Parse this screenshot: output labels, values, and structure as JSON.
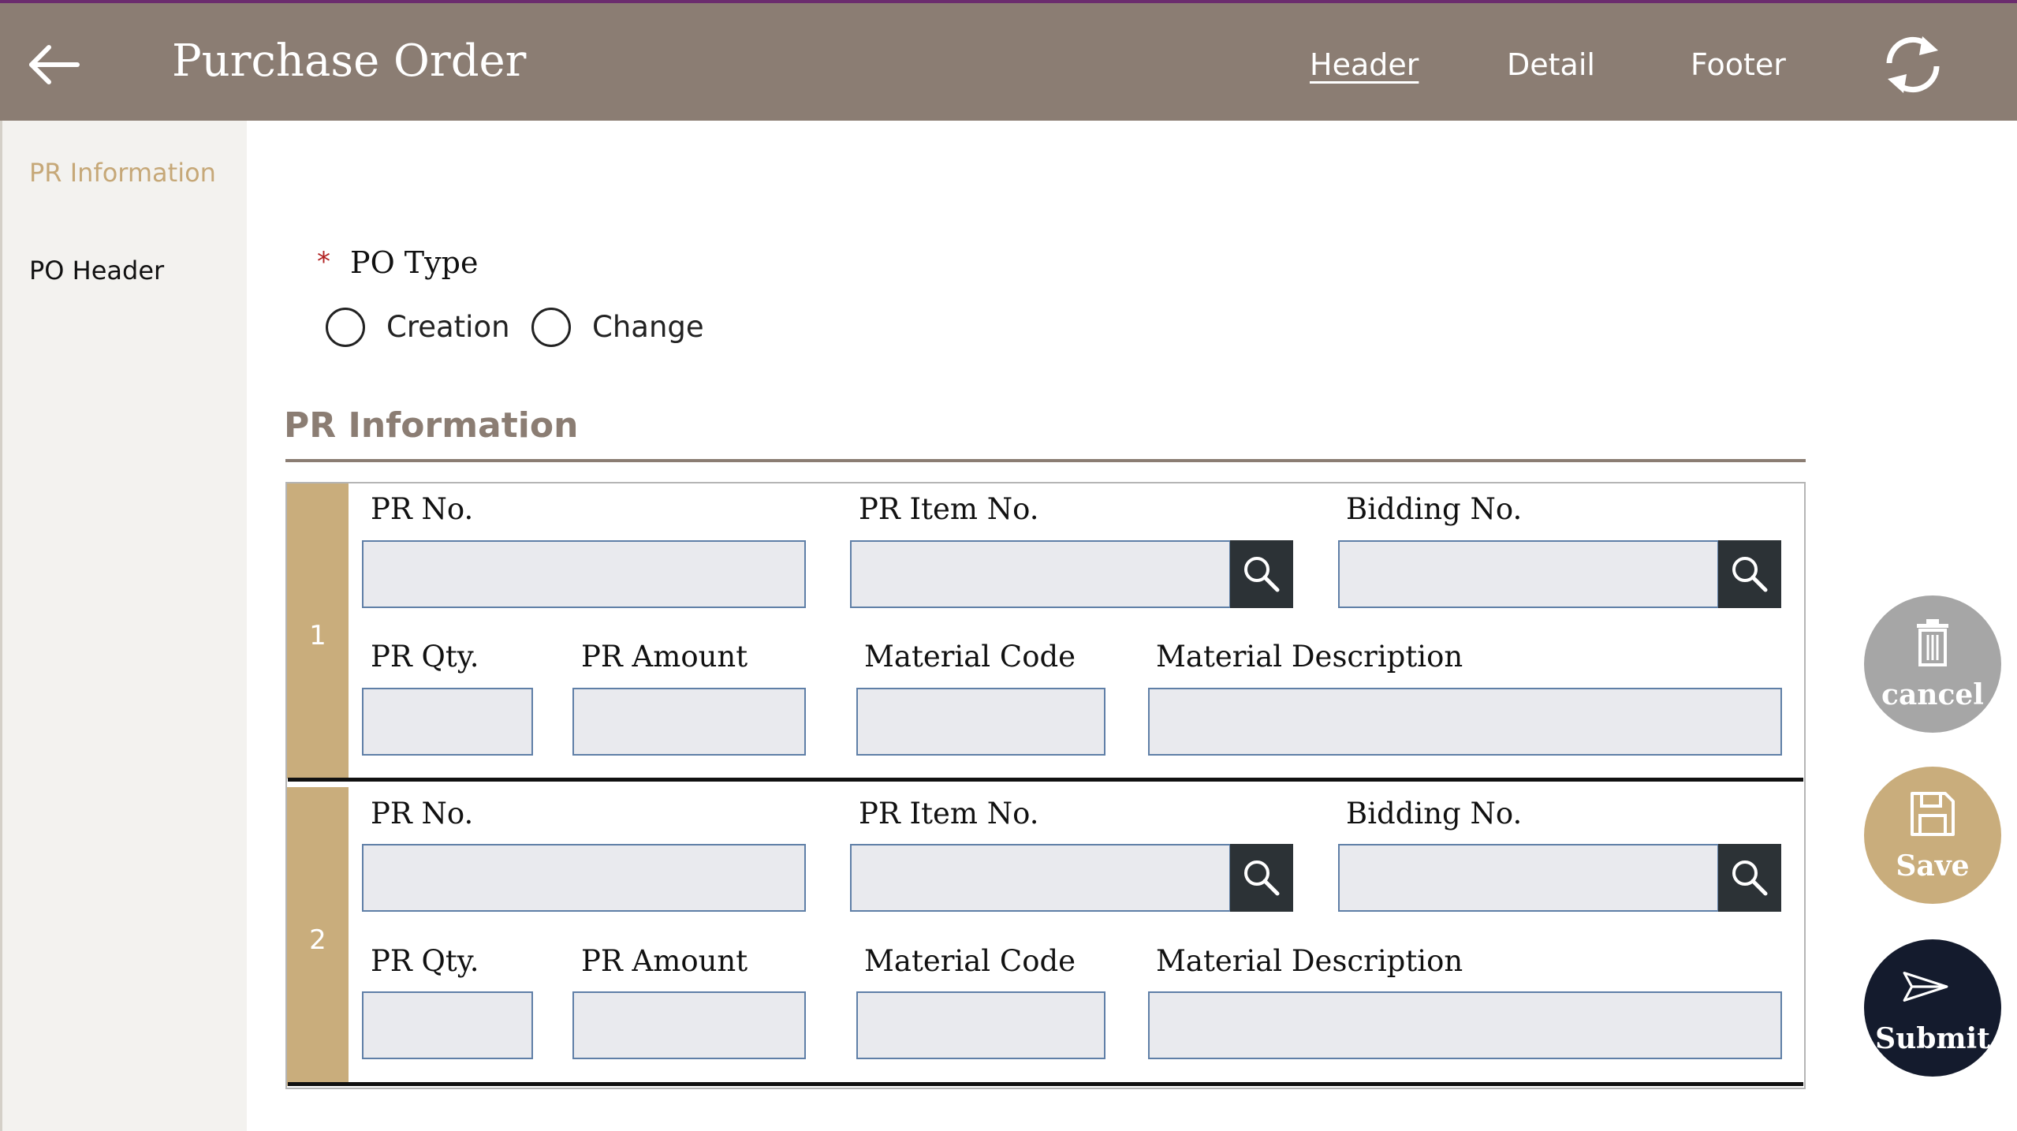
{
  "header": {
    "title": "Purchase Order",
    "tabs": [
      "Header",
      "Detail",
      "Footer"
    ],
    "active_tab": "Header"
  },
  "sidebar": {
    "items": [
      "PR Information",
      "PO Header"
    ],
    "active_item": "PR Information"
  },
  "po_type": {
    "label": "PO Type",
    "required_marker": "*",
    "options": [
      "Creation",
      "Change"
    ],
    "selected": null
  },
  "pr_section": {
    "title": "PR Information",
    "rows": [
      {
        "number": "1",
        "labels": {
          "pr_no": "PR No.",
          "pr_item_no": "PR Item No.",
          "bidding_no": "Bidding No.",
          "pr_qty": "PR Qty.",
          "pr_amount": "PR Amount",
          "material_code": "Material Code",
          "material_description": "Material Description"
        },
        "values": {
          "pr_no": "",
          "pr_item_no": "",
          "bidding_no": "",
          "pr_qty": "",
          "pr_amount": "",
          "material_code": "",
          "material_description": ""
        }
      },
      {
        "number": "2",
        "labels": {
          "pr_no": "PR No.",
          "pr_item_no": "PR Item No.",
          "bidding_no": "Bidding No.",
          "pr_qty": "PR Qty.",
          "pr_amount": "PR Amount",
          "material_code": "Material Code",
          "material_description": "Material Description"
        },
        "values": {
          "pr_no": "",
          "pr_item_no": "",
          "bidding_no": "",
          "pr_qty": "",
          "pr_amount": "",
          "material_code": "",
          "material_description": ""
        }
      }
    ]
  },
  "actions": {
    "cancel": "cancel",
    "save": "Save",
    "submit": "Submit"
  },
  "icons": {
    "back": "arrow-left-icon",
    "refresh": "refresh-icon",
    "lookup": "search-icon",
    "cancel": "trash-icon",
    "save": "floppy-disk-icon",
    "submit": "paper-plane-icon"
  },
  "colors": {
    "header_bg": "#8b7d73",
    "accent_gold": "#c6a878",
    "row_bar": "#c9ad7c",
    "lookup_bg": "#2c3236",
    "field_bg": "#e9eaee",
    "field_border": "#5f7fa7",
    "cancel_fab": "#a6a6a6",
    "save_fab": "#c9ad7c",
    "submit_fab": "#141b2d",
    "required": "#b22222"
  }
}
